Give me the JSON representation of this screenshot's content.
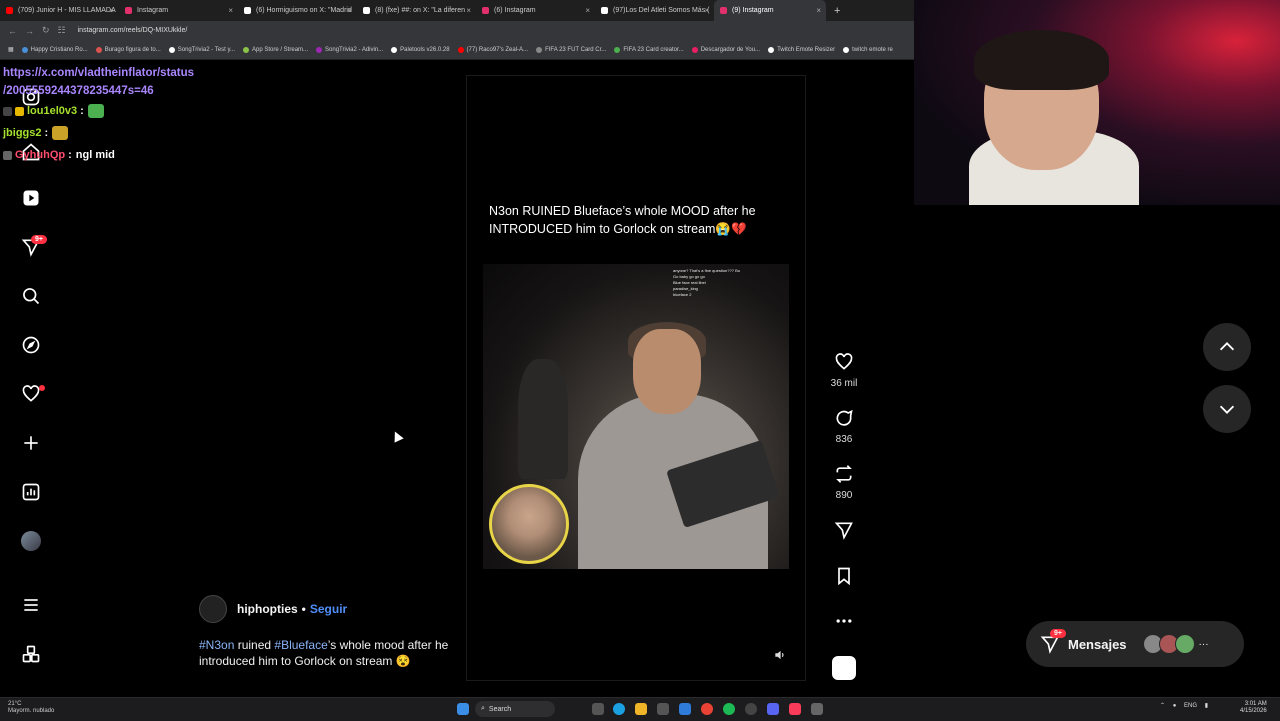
{
  "browser": {
    "tabs": [
      {
        "label": "(709) Junior H - MIS LLAMADA",
        "color": "#ff0000"
      },
      {
        "label": "Instagram",
        "color": "#e1306c"
      },
      {
        "label": "(6) Hormiguismo on X: \"Madrid",
        "color": "#ffffff"
      },
      {
        "label": "(8) (fxe) ##: on X: \"La diferen",
        "color": "#ffffff"
      },
      {
        "label": "(6) Instagram",
        "color": "#e1306c"
      },
      {
        "label": "(97)Los Del Atleti Somos Más (",
        "color": "#ffffff"
      },
      {
        "label": "(9) Instagram",
        "color": "#e1306c"
      }
    ],
    "new_tab": "+",
    "url": "instagram.com/reels/DQ-MIXUkkle/",
    "bookmarks": [
      {
        "label": "Happy Cristiano Ro...",
        "color": "#4a90d9"
      },
      {
        "label": "Burago figura de to...",
        "color": "#d9534f"
      },
      {
        "label": "SongTrivia2 - Test y...",
        "color": "#ffffff"
      },
      {
        "label": "App Store / Stream...",
        "color": "#8bc34a"
      },
      {
        "label": "SongTrivia2 - Adivin...",
        "color": "#9c27b0"
      },
      {
        "label": "Paletools v26.0.28",
        "color": "#ffffff"
      },
      {
        "label": "(77) Raco97's Zeal-A...",
        "color": "#ff0000"
      },
      {
        "label": "FIFA 23 FUT Card Cr...",
        "color": "#888888"
      },
      {
        "label": "FIFA 23 Card creator...",
        "color": "#4caf50"
      },
      {
        "label": "Descargador de You...",
        "color": "#e91e63"
      },
      {
        "label": "Twitch Emote Resizer",
        "color": "#ffffff"
      },
      {
        "label": "twitch emote re",
        "color": "#ffffff"
      }
    ]
  },
  "chat": {
    "link_line1": "https://x.com/vladtheinflator/status",
    "link_line2": "/2005559244378235447s=46",
    "messages": [
      {
        "user": "lou1el0v3",
        "sep": ":",
        "text": "",
        "color": "#a6e22e"
      },
      {
        "user": "jbiggs2",
        "sep": ":",
        "text": "",
        "color": "#a6e22e"
      },
      {
        "user": "GyhuhQp",
        "sep": ":",
        "text": "ngl mid",
        "color": "#ff4d6d"
      }
    ]
  },
  "sidebar": {
    "notification_badge": "9+",
    "icons": [
      "instagram-logo-icon",
      "home-icon",
      "reels-icon",
      "messages-icon",
      "search-icon",
      "explore-icon",
      "notifications-icon",
      "create-icon",
      "dashboard-icon",
      "profile-avatar",
      "menu-icon",
      "more-apps-icon"
    ]
  },
  "reel": {
    "caption": "N3on RUINED Blueface’s whole MOOD after he INTRODUCED him to Gorlock on stream😭💔",
    "author": "hiphopties",
    "follow": "Seguir",
    "dot": "•",
    "desc_tag1": "#N3on",
    "desc_mid1": " ruined ",
    "desc_tag2": "#Blueface",
    "desc_rest": "’s whole mood after he introduced him to Gorlock on stream 😵",
    "video_chat_overlay": [
      "anyone? That's a fine question??? Bu",
      "Go baby go go go",
      "Blue face real libel",
      "paradise_king",
      "blueface  2"
    ]
  },
  "actions": {
    "likes": "36 mil",
    "comments": "836",
    "reposts": "890"
  },
  "messages_pill": {
    "badge": "9+",
    "label": "Mensajes",
    "more": "···"
  },
  "taskbar": {
    "weather_temp": "21°C",
    "weather_desc": "Mayorm. nublado",
    "search": "Search",
    "lang": "ENG",
    "time": "3:01 AM",
    "date": "4/15/2026"
  },
  "colors": {
    "accent": "#4f8ef7",
    "badge": "#ff3040",
    "chat_link": "#a986ff"
  }
}
